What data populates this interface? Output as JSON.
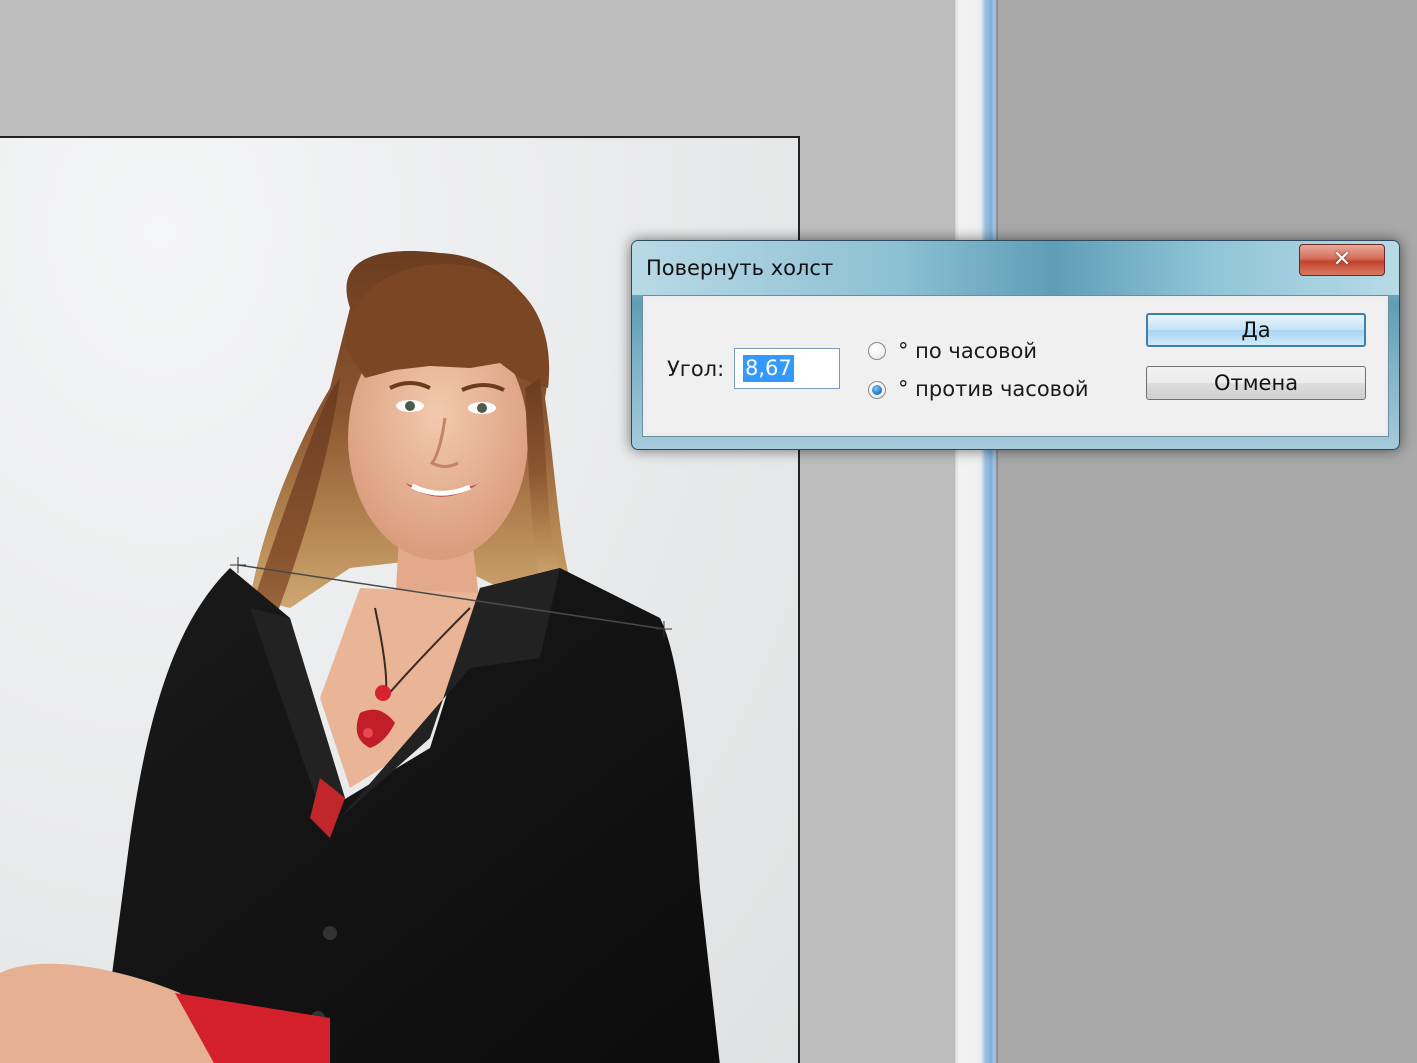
{
  "dialog": {
    "title": "Повернуть холст",
    "close_icon": "close-icon",
    "angle_label": "Угол:",
    "angle_value": "8,67",
    "rotation_options": [
      {
        "label": "° по часовой",
        "checked": false
      },
      {
        "label": "° против часовой",
        "checked": true
      }
    ],
    "ok_label": "Да",
    "cancel_label": "Отмена",
    "close_glyph": "✕"
  },
  "colors": {
    "selection_highlight": "#3399ff",
    "workspace": "#bdbdbd",
    "dialog_frame": "#5f9db5"
  }
}
